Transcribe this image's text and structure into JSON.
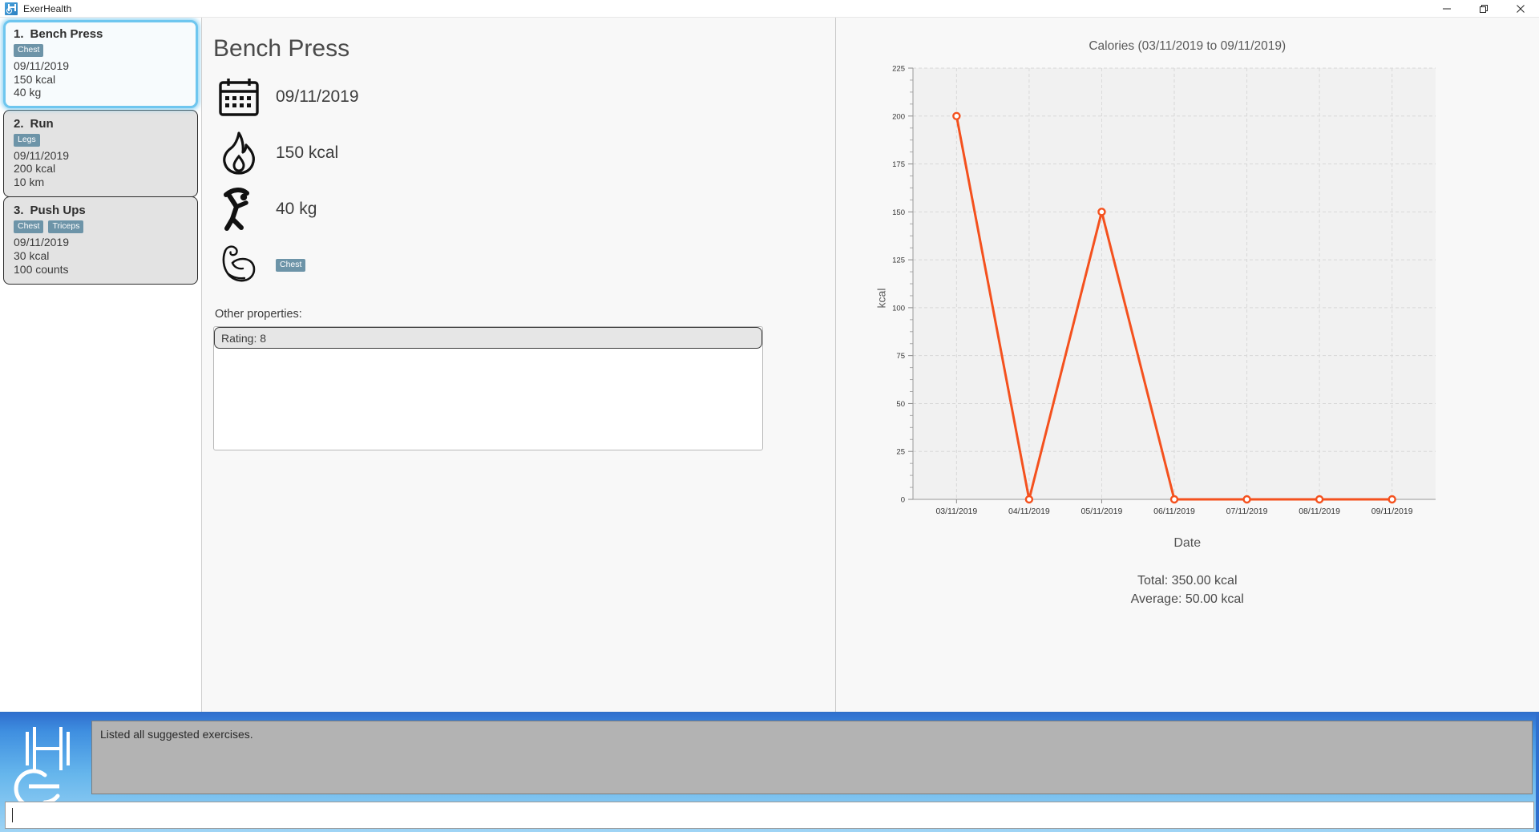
{
  "window": {
    "title": "ExerHealth",
    "icon": "app-logo-icon",
    "controls": {
      "minimize": "—",
      "maximize": "❐",
      "close": "✕"
    }
  },
  "exercise_list": [
    {
      "number": "1.",
      "name": "Bench Press",
      "tags": [
        "Chest"
      ],
      "date": "09/11/2019",
      "calories": "150 kcal",
      "measure": "40 kg",
      "selected": true
    },
    {
      "number": "2.",
      "name": "Run",
      "tags": [
        "Legs"
      ],
      "date": "09/11/2019",
      "calories": "200 kcal",
      "measure": "10 km",
      "selected": false
    },
    {
      "number": "3.",
      "name": "Push Ups",
      "tags": [
        "Chest",
        "Triceps"
      ],
      "date": "09/11/2019",
      "calories": "30 kcal",
      "measure": "100 counts",
      "selected": false
    }
  ],
  "detail": {
    "title": "Bench Press",
    "date": "09/11/2019",
    "calories": "150 kcal",
    "measure": "40 kg",
    "muscle_tag": "Chest",
    "other_properties_label": "Other properties:",
    "properties": [
      {
        "text": "Rating: 8"
      }
    ]
  },
  "chart_data": {
    "type": "line",
    "title": "Calories (03/11/2019 to 09/11/2019)",
    "xlabel": "Date",
    "ylabel": "kcal",
    "categories": [
      "03/11/2019",
      "04/11/2019",
      "05/11/2019",
      "06/11/2019",
      "07/11/2019",
      "08/11/2019",
      "09/11/2019"
    ],
    "values": [
      200,
      0,
      150,
      0,
      0,
      0,
      0
    ],
    "ylim": [
      0,
      225
    ],
    "yticks": [
      0,
      25,
      50,
      75,
      100,
      125,
      150,
      175,
      200,
      225
    ],
    "grid": true,
    "legend": "none",
    "series_color": "#f4511e",
    "marker": "open-circle",
    "total_label": "Total: 350.00 kcal",
    "average_label": "Average: 50.00 kcal"
  },
  "console": {
    "logo": "exerhealth-logo-icon",
    "log_message": "Listed all suggested exercises.",
    "command_value": "",
    "command_placeholder": ""
  },
  "colors": {
    "accent": "#6ec6ef",
    "tag": "#6d94a8",
    "series": "#f4511e",
    "console_top": "#2f6fce"
  }
}
